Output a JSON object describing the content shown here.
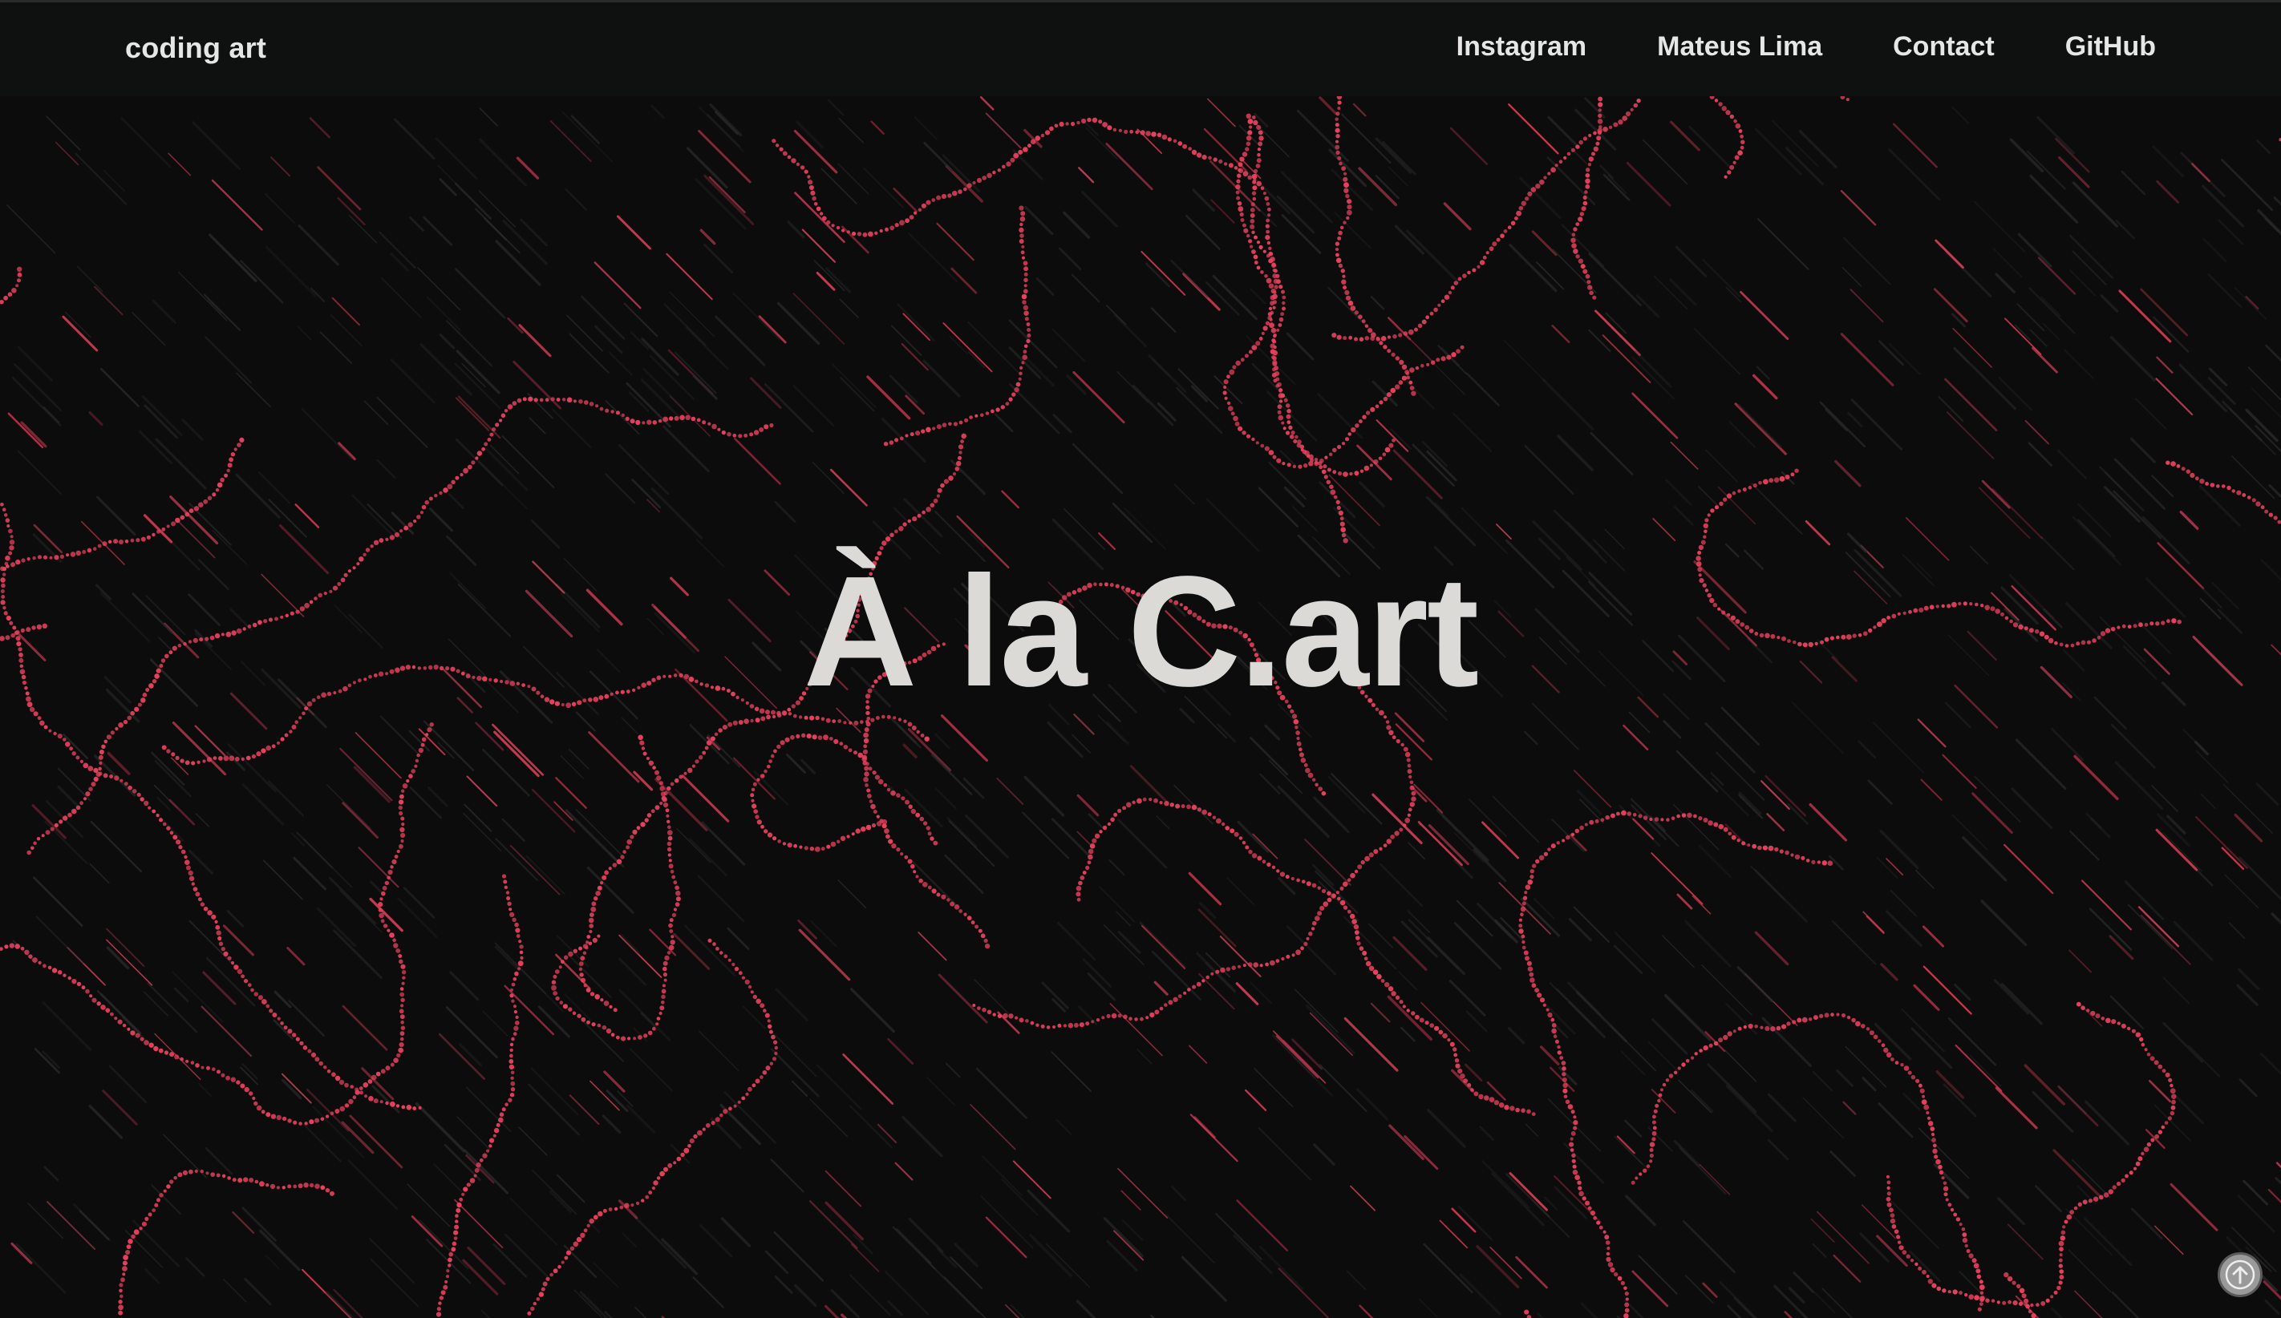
{
  "navbar": {
    "brand": "coding art",
    "links": [
      {
        "label": "Instagram"
      },
      {
        "label": "Mateus Lima"
      },
      {
        "label": "Contact"
      },
      {
        "label": "GitHub"
      }
    ]
  },
  "hero": {
    "title": "À la C.art"
  },
  "scroll_top": {
    "icon": "arrow-up-circle-icon"
  },
  "colors": {
    "background": "#0c0c0c",
    "navbar": "#0f1111",
    "accent": "#e8415e",
    "text": "#e6e6e6"
  }
}
